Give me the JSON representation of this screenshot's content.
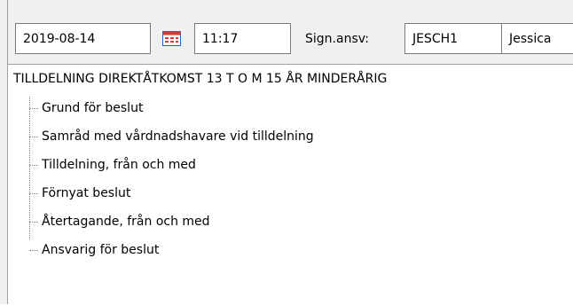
{
  "header": {
    "date_value": "2019-08-14",
    "time_value": "11:17",
    "sign_label": "Sign.ansv:",
    "sign_id": "JESCH1",
    "sign_name": "Jessica"
  },
  "icons": {
    "calendar": "calendar-icon"
  },
  "tree": {
    "root_label": "TILLDELNING DIREKTÅTKOMST 13 T O M 15 ÅR MINDERÅRIG",
    "items": [
      {
        "label": "Grund för beslut"
      },
      {
        "label": "Samråd med vårdnadshavare vid tilldelning"
      },
      {
        "label": "Tilldelning, från och med"
      },
      {
        "label": "Förnyat beslut"
      },
      {
        "label": "Återtagande, från och med"
      },
      {
        "label": "Ansvarig för beslut"
      }
    ]
  },
  "colors": {
    "chrome": "#f0f0f0",
    "field_border": "#7a7a7a",
    "calendar_red": "#d93a2b",
    "calendar_blue": "#2a62c9"
  }
}
